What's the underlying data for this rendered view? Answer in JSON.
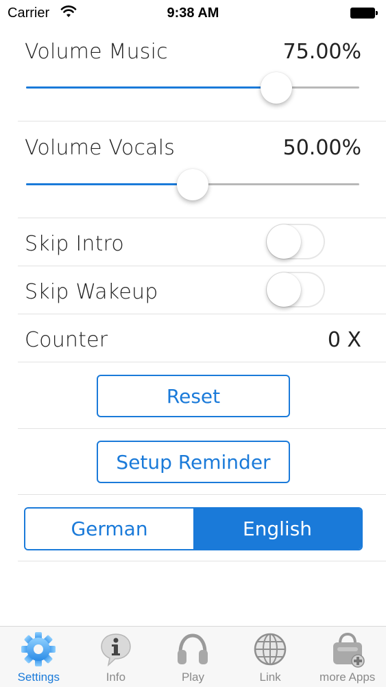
{
  "status_bar": {
    "carrier": "Carrier",
    "time": "9:38 AM"
  },
  "settings": {
    "volume_music": {
      "label": "Volume Music",
      "value_text": "75.00%",
      "level": 0.75
    },
    "volume_vocals": {
      "label": "Volume Vocals",
      "value_text": "50.00%",
      "level": 0.5
    },
    "skip_intro": {
      "label": "Skip Intro",
      "on": false
    },
    "skip_wakeup": {
      "label": "Skip Wakeup",
      "on": false
    },
    "counter": {
      "label": "Counter",
      "value": "0 X"
    },
    "reset_label": "Reset",
    "setup_reminder_label": "Setup Reminder",
    "language": {
      "options": [
        "German",
        "English"
      ],
      "selected": "English"
    }
  },
  "tab_bar": {
    "items": [
      {
        "label": "Settings",
        "icon": "gear-icon",
        "active": true
      },
      {
        "label": "Info",
        "icon": "info-icon",
        "active": false
      },
      {
        "label": "Play",
        "icon": "headphones-icon",
        "active": false
      },
      {
        "label": "Link",
        "icon": "globe-icon",
        "active": false
      },
      {
        "label": "more Apps",
        "icon": "apps-bag-icon",
        "active": false
      }
    ]
  },
  "colors": {
    "accent": "#1a7ad9",
    "separator": "#e2e2e2",
    "tab_inactive": "#8a8a8a"
  }
}
